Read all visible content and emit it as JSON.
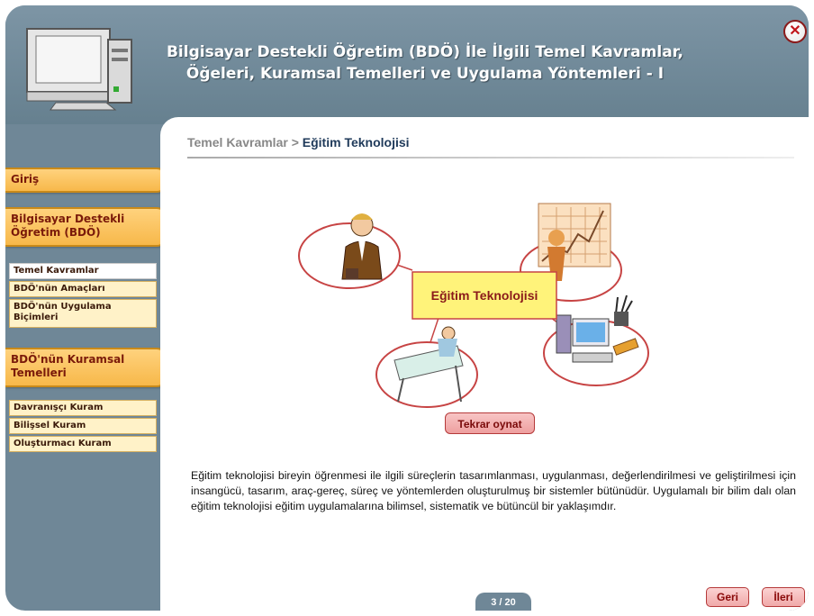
{
  "header": {
    "title_line1": "Bilgisayar Destekli Öğretim (BDÖ) İle İlgili Temel Kavramlar,",
    "title_line2": "Öğeleri, Kuramsal Temelleri ve Uygulama Yöntemleri - I",
    "close_glyph": "✕"
  },
  "sidebar": {
    "sections": [
      {
        "label": "Giriş"
      },
      {
        "label_line1": "Bilgisayar Destekli",
        "label_line2": "Öğretim (BDÖ)"
      },
      {
        "label_line1": "BDÖ'nün Kuramsal",
        "label_line2": "Temelleri"
      }
    ],
    "bdo_items": [
      {
        "label": "Temel Kavramlar",
        "active": true
      },
      {
        "label": "BDÖ'nün Amaçları"
      },
      {
        "label_line1": "BDÖ'nün Uygulama",
        "label_line2": "Biçimleri"
      }
    ],
    "kuram_items": [
      {
        "label": "Davranışçı Kuram"
      },
      {
        "label": "Bilişsel Kuram"
      },
      {
        "label": "Oluşturmacı Kuram"
      }
    ]
  },
  "breadcrumb": {
    "parent": "Temel Kavramlar",
    "separator": ">",
    "current": "Eğitim Teknolojisi"
  },
  "diagram": {
    "center_label": "Eğitim Teknolojisi"
  },
  "replay_button": "Tekrar oynat",
  "description": "Eğitim teknolojisi bireyin öğrenmesi ile ilgili süreçlerin tasarımlanması, uygulanması, değerlendirilmesi ve geliştirilmesi için insangücü, tasarım, araç-gereç, süreç ve yöntemlerden oluşturulmuş bir sistemler bütünüdür. Uygulamalı bir bilim dalı olan eğitim teknolojisi eğitim uygulamalarına bilimsel, sistematik ve bütüncül bir yaklaşımdır.",
  "navigation": {
    "prev": "Geri",
    "next": "İleri",
    "page_counter": "3 / 20"
  },
  "colors": {
    "frame": "#6f8797",
    "tab_orange": "#f7b84a",
    "accent_red": "#c0151a",
    "box_yellow": "#fff37a",
    "ellipse_red": "#c74444"
  }
}
